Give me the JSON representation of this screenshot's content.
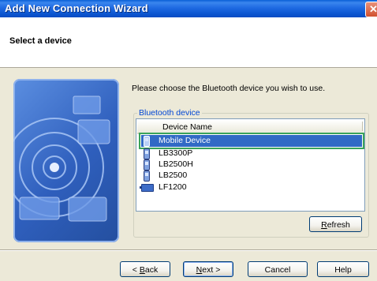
{
  "window": {
    "title": "Add New Connection Wizard",
    "close_glyph": "✕"
  },
  "header": {
    "title": "Select a device"
  },
  "content": {
    "prompt": "Please choose the Bluetooth device you wish to use.",
    "group_label": "Bluetooth device",
    "column_header": "Device Name",
    "devices": [
      {
        "name": "Mobile Device",
        "icon": "phone-icon",
        "selected": true
      },
      {
        "name": "LB3300P",
        "icon": "phone-icon",
        "selected": false
      },
      {
        "name": "LB2500H",
        "icon": "phone-icon",
        "selected": false
      },
      {
        "name": "LB2500",
        "icon": "phone-icon",
        "selected": false
      },
      {
        "name": "LF1200",
        "icon": "bluetooth-adapter-icon",
        "selected": false
      }
    ],
    "refresh_button": {
      "pre": "",
      "mnemonic": "R",
      "post": "efresh"
    }
  },
  "buttons": {
    "back": {
      "pre": "< ",
      "mnemonic": "B",
      "post": "ack"
    },
    "next": {
      "pre": "",
      "mnemonic": "N",
      "post": "ext >"
    },
    "cancel": "Cancel",
    "help": "Help"
  },
  "colors": {
    "titlebar": "#0b55d0",
    "selection": "#316ac5",
    "group_label": "#0046d5"
  }
}
